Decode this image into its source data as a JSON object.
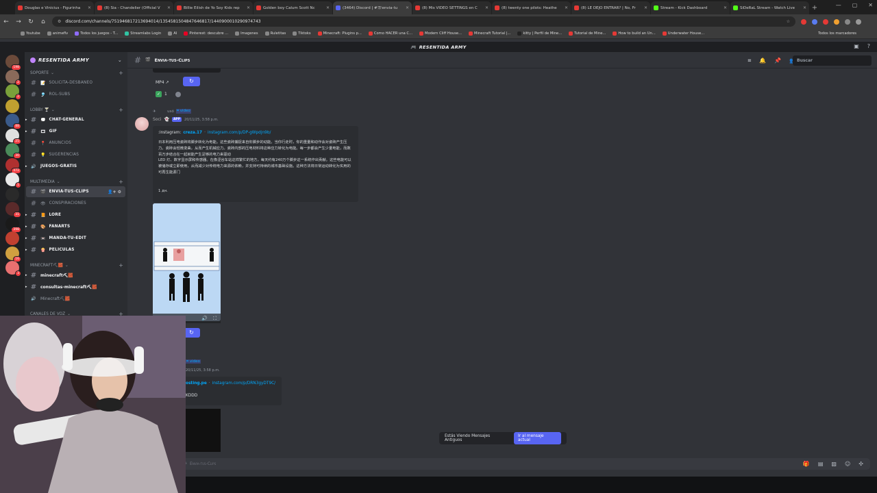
{
  "browser": {
    "tabs": [
      {
        "title": "Douglas e Vinicius - Figurinha",
        "color": "#e53935"
      },
      {
        "title": "(8) Sia - Chandelier (Official V",
        "color": "#e53935"
      },
      {
        "title": "Billie Eilish de Yo Soy Kids rep",
        "color": "#e53935"
      },
      {
        "title": "Golden boy Calum Scott Nc",
        "color": "#e53935"
      },
      {
        "title": "(3464) Discord | #🎬envia-tu",
        "color": "#5865f2"
      },
      {
        "title": "(8) Mis VIDEO SETTINGS en C",
        "color": "#e53935"
      },
      {
        "title": "(8) twenty one pilots: Heathe",
        "color": "#e53935"
      },
      {
        "title": "(8) LE DEJO ENTRAR? | No, Fr",
        "color": "#e53935"
      },
      {
        "title": "Stream - Kick Dashboard",
        "color": "#53fc18"
      },
      {
        "title": "SiDeRaL Stream - Watch Live",
        "color": "#53fc18"
      }
    ],
    "url": "discord.com/channels/751946817213694014/1354581504847646817/1440900010290974743",
    "bookmarks": [
      {
        "label": "Youtube",
        "color": "#888"
      },
      {
        "label": "animeflv",
        "color": "#888"
      },
      {
        "label": "Todos los juegos - T...",
        "color": "#8e6cff"
      },
      {
        "label": "Streamlabs Login",
        "color": "#31c3a2"
      },
      {
        "label": "AI",
        "color": "#888"
      },
      {
        "label": "Pinterest: descubre ...",
        "color": "#e60023"
      },
      {
        "label": "Imagenes",
        "color": "#888"
      },
      {
        "label": "Ruletitas",
        "color": "#888"
      },
      {
        "label": "Tiktoks",
        "color": "#888"
      },
      {
        "label": "Minecraft: Plugins p...",
        "color": "#e53935"
      },
      {
        "label": "Como HACER una C...",
        "color": "#e53935"
      },
      {
        "label": "Modern Cliff House...",
        "color": "#e53935"
      },
      {
        "label": "Minecraft Tutorial |...",
        "color": "#e53935"
      },
      {
        "label": "kitty | Perfil de Mine...",
        "color": "#222"
      },
      {
        "label": "Tutorial de Mine...",
        "color": "#e53935"
      },
      {
        "label": "How to build an Un...",
        "color": "#e53935"
      },
      {
        "label": "Underwater House...",
        "color": "#e53935"
      }
    ],
    "other_bookmarks": "Todos los marcadores"
  },
  "discord": {
    "top_title": "RESENTIDA ARMY",
    "server_name": "RESENTIDA ARMY",
    "search_placeholder": "Buscar",
    "server_badges": [
      "198",
      "2",
      "2",
      "",
      "88",
      "25",
      "30",
      "472",
      "1",
      "",
      "31",
      "398",
      "",
      "16",
      "3"
    ],
    "categories": [
      {
        "label": "SOPORTE"
      },
      {
        "label": "LOBBY 🍸"
      },
      {
        "label": "MULTIMEDIA"
      },
      {
        "label": "MINECRAFT⛏🧱"
      },
      {
        "label": "CANALES DE VOZ"
      }
    ],
    "channels": [
      {
        "emoji": "📝",
        "label": "Solicita-Desbaneo",
        "bold": false
      },
      {
        "emoji": "🎐",
        "label": "rol-subs",
        "bold": false
      },
      {
        "emoji": "💭",
        "label": "Chat-General",
        "bold": true
      },
      {
        "emoji": "🎞",
        "label": "GIF",
        "bold": true
      },
      {
        "emoji": "📍",
        "label": "Anuncios",
        "bold": false
      },
      {
        "emoji": "💡",
        "label": "sugerencias",
        "bold": false
      },
      {
        "emoji": "",
        "label": "juegos-gratis",
        "bold": true
      },
      {
        "emoji": "🎬",
        "label": "Envia-tus-Clips",
        "bold": true
      },
      {
        "emoji": "👁",
        "label": "Conspiraciones",
        "bold": false
      },
      {
        "emoji": "📙",
        "label": "Lore",
        "bold": true
      },
      {
        "emoji": "🎨",
        "label": "fanarts",
        "bold": true
      },
      {
        "emoji": "📼",
        "label": "manda-tu-edit",
        "bold": true
      },
      {
        "emoji": "🍿",
        "label": "peliculas",
        "bold": true
      },
      {
        "emoji": "",
        "label": "minecraft⛏🧱",
        "bold": true
      },
      {
        "emoji": "",
        "label": "consultas-minecraft⛏🧱",
        "bold": true
      },
      {
        "emoji": "",
        "label": "Minecraft⛏🧱",
        "bold": false
      }
    ],
    "current_channel": "Envia-tus-Clips",
    "messages": {
      "prev_pill": "MP4",
      "reaction_count": "1",
      "reply_line": "usó",
      "reply_cmd": "video",
      "bot_name": "Soci",
      "app_tag": "APP",
      "timestamp": "20/11/25, 3:58 p.m.",
      "embed_prefix": ":instagram:",
      "embed_user": "creza.17",
      "embed_sep": "·",
      "embed_link": "instagram.com/p/DP-gWpdjn9b/",
      "embed_text": "日本利用压电瓷砖将脚步转化为电能。这些瓷砖捕捉来自你脚步的动能。当你行走时，你的重量和动作会对瓷砖产生压力。瓷砖会轻微变曲，从而产生机械应力。瓷砖内部的压电材料将这种应力转化为电能。每一步都会产生少量电能，而数百万步结合在一起就能产生足够的电力来驱动\nLED 灯、数字显示屏和传感器。在像涩谷车站这样繁忙的地方，每天约有240万个脚步这一系统作出贡献。这些电能可以被储存或立即使用，从而减少对传统电力来源的依赖，并支持可持续的城市基础设施。这种方法将日常运动转化为实用的可再生能源门",
      "embed_footer": "1 дн.",
      "reply_cmd_2": "video",
      "timestamp_2": "20/11/25, 3:58 p.m.",
      "embed2_user": "osting.pe",
      "embed2_link": "instagram.com/p/DRN3gyDT9C/",
      "embed2_text": "KDDD"
    },
    "banner_text": "Estás Viendo Mensajes Antiguos",
    "banner_button": "Ir al mensaje actual",
    "composer_placeholder": "Envia-tus-Clips"
  }
}
